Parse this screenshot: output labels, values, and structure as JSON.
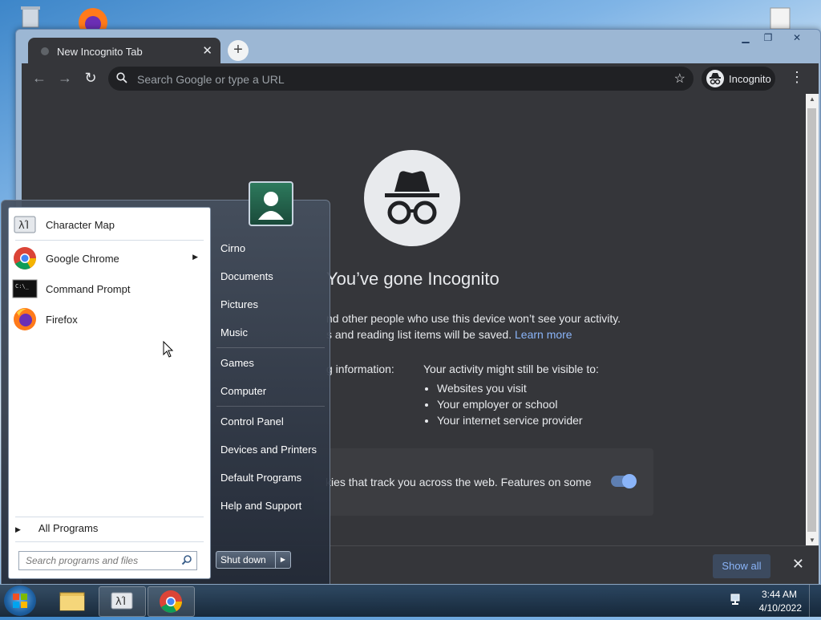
{
  "browser": {
    "tab_title": "New Incognito Tab",
    "tab_close": "✕",
    "new_tab": "+",
    "omnibox_placeholder": "Search Google or type a URL",
    "incognito_chip": "Incognito",
    "heading": "You’ve gone Incognito",
    "para_line1": "nd other people who use this device won’t see your activity.",
    "para_line2": "s and reading list items will be saved.",
    "learn_more": "Learn more",
    "left_col": "g information:",
    "right_col_title": "Your activity might still be visible to:",
    "right_col_items": [
      "Websites you visit",
      "Your employer or school",
      "Your internet service provider"
    ],
    "cookie_text": "kies that track you across the web. Features on some",
    "cookie_toggle_on": true,
    "show_all": "Show all"
  },
  "start_menu": {
    "programs": [
      {
        "label": "Character Map",
        "icon": "character-map-icon"
      },
      {
        "label": "Google Chrome",
        "icon": "chrome-icon",
        "has_submenu": true
      },
      {
        "label": "Command Prompt",
        "icon": "command-prompt-icon"
      },
      {
        "label": "Firefox",
        "icon": "firefox-icon"
      }
    ],
    "all_programs": "All Programs",
    "search_placeholder": "Search programs and files",
    "right_items": [
      "Cirno",
      "Documents",
      "Pictures",
      "Music",
      "Games",
      "Computer",
      "Control Panel",
      "Devices and Printers",
      "Default Programs",
      "Help and Support"
    ],
    "shutdown": "Shut down"
  },
  "taskbar": {
    "time": "3:44 AM",
    "date": "4/10/2022"
  }
}
